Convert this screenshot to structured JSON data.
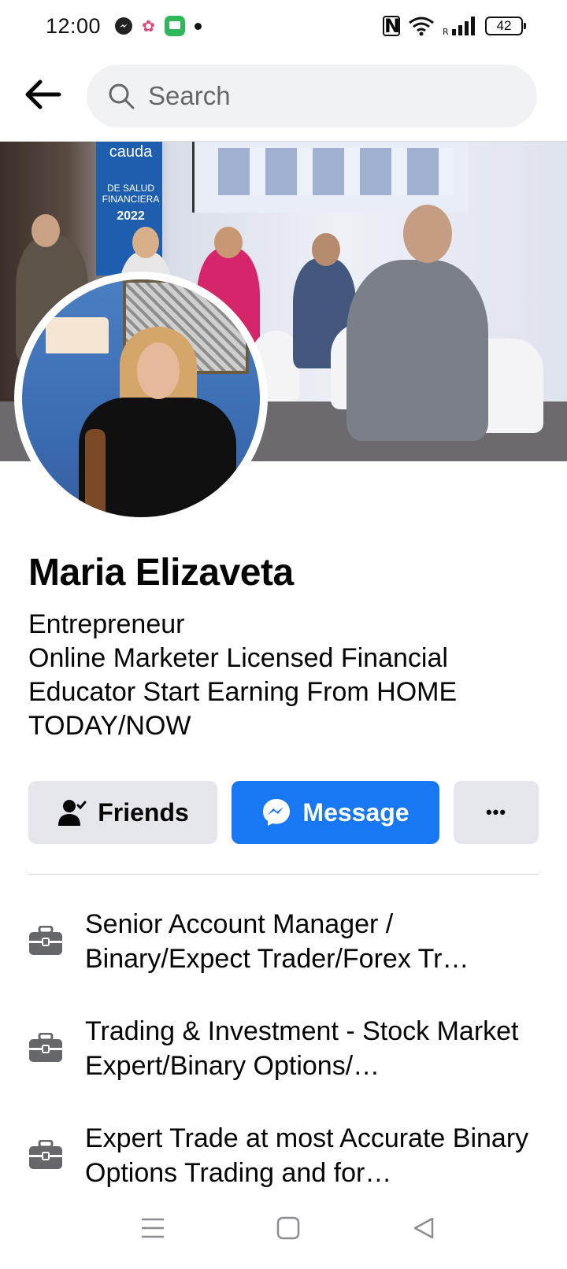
{
  "status_bar": {
    "time": "12:00",
    "battery": "42"
  },
  "header": {
    "search_placeholder": "Search"
  },
  "cover": {
    "banner_brand": "cauda",
    "banner_title": "DE SALUD FINANCIERA",
    "banner_year": "2022"
  },
  "profile": {
    "name": "Maria Elizaveta",
    "bio_line1": "Entrepreneur",
    "bio_line2": "Online Marketer Licensed Financial Educator Start Earning From HOME TODAY/NOW"
  },
  "actions": {
    "friends_label": "Friends",
    "message_label": "Message",
    "more_label": "•••"
  },
  "work": [
    {
      "text": "Senior Account Manager / Binary/Expect Trader/Forex Tr…"
    },
    {
      "text": "Trading & Investment - Stock Market Expert/Binary Options/…"
    },
    {
      "text": "Expert Trade at most Accurate Binary Options Trading and for…"
    }
  ],
  "colors": {
    "accent": "#1877f2",
    "button_gray": "#e4e6eb",
    "text": "#050505",
    "muted": "#65676b"
  }
}
